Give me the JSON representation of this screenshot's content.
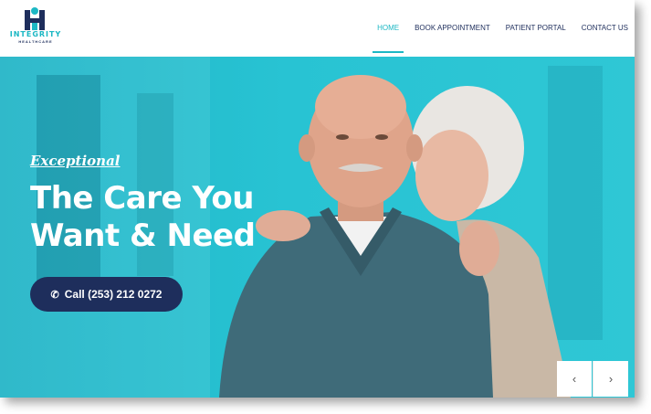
{
  "brand": {
    "name": "INTEGRITY",
    "subtitle": "HEALTHCARE",
    "colors": {
      "teal": "#1db8c4",
      "navy": "#1e2e5c"
    }
  },
  "nav": {
    "items": [
      {
        "label": "HOME",
        "active": true
      },
      {
        "label": "BOOK APPOINTMENT",
        "active": false
      },
      {
        "label": "PATIENT PORTAL",
        "active": false
      },
      {
        "label": "CONTACT US",
        "active": false
      }
    ]
  },
  "hero": {
    "tagline": "Exceptional",
    "headline_line1": "The Care You",
    "headline_line2": "Want & Need",
    "cta_label": "Call (253) 212 0272",
    "cta_icon": "phone-icon"
  },
  "slider": {
    "prev_icon": "chevron-left-icon",
    "next_icon": "chevron-right-icon"
  }
}
